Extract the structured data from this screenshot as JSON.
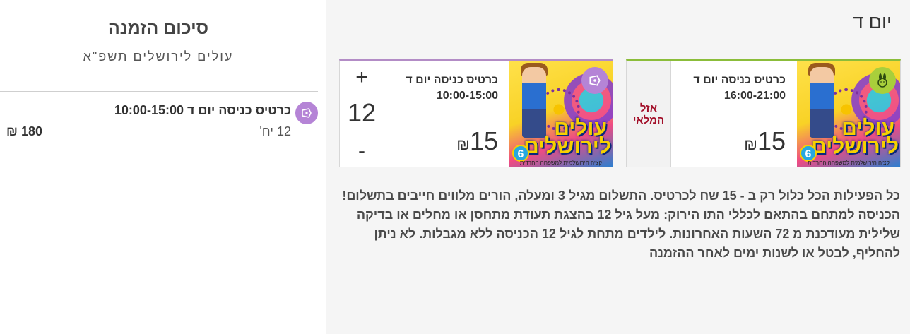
{
  "summary": {
    "title": "סיכום הזמנה",
    "subtitle": "עולים לירושלים תשפ\"א",
    "item_name": "כרטיס כניסה יום ד 10:00-15:00",
    "item_qty": "12 יח'",
    "item_total": "180 ₪",
    "item_icon": "ticket-icon"
  },
  "day_title": "יום ד",
  "tickets": [
    {
      "name": "כרטיס כניסה יום ד",
      "time": "10:00-15:00",
      "price": "15",
      "currency": "₪",
      "quantity": "12",
      "plus": "+",
      "minus": "-",
      "badge_icon": "ticket-icon",
      "poster_line1": "עולים",
      "poster_line2": "לירושלים",
      "poster_number": "6",
      "poster_tagline": "קציה הירושלמית למשפחה החרדית"
    },
    {
      "name": "כרטיס כניסה יום ד",
      "time": "16:00-21:00",
      "price": "15",
      "currency": "₪",
      "status": "אזל המלאי",
      "badge_icon": "rabbit-icon",
      "poster_line1": "עולים",
      "poster_line2": "לירושלים",
      "poster_number": "6",
      "poster_tagline": "קציה הירושלמית למשפחה החרדית"
    }
  ],
  "info": "כל הפעילות הכל כלול  רק ב - 15 שח לכרטיס. התשלום מגיל 3 ומעלה, הורים מלווים חייבים בתשלום! הכניסה למתחם בהתאם לכללי התו הירוק: מעל גיל 12 בהצגת תעודת מתחסן או מחלים או בדיקה שלילית מעודכנת מ 72 השעות האחרונות. לילדים מתחת לגיל 12 הכניסה ללא מגבלות. לא ניתן להחליף, לבטל או לשנות ימים לאחר ההזמנה",
  "colors": {
    "accent_purple": "#b584d6",
    "accent_green": "#a9cf3b",
    "soldout_red": "#a3102a"
  }
}
